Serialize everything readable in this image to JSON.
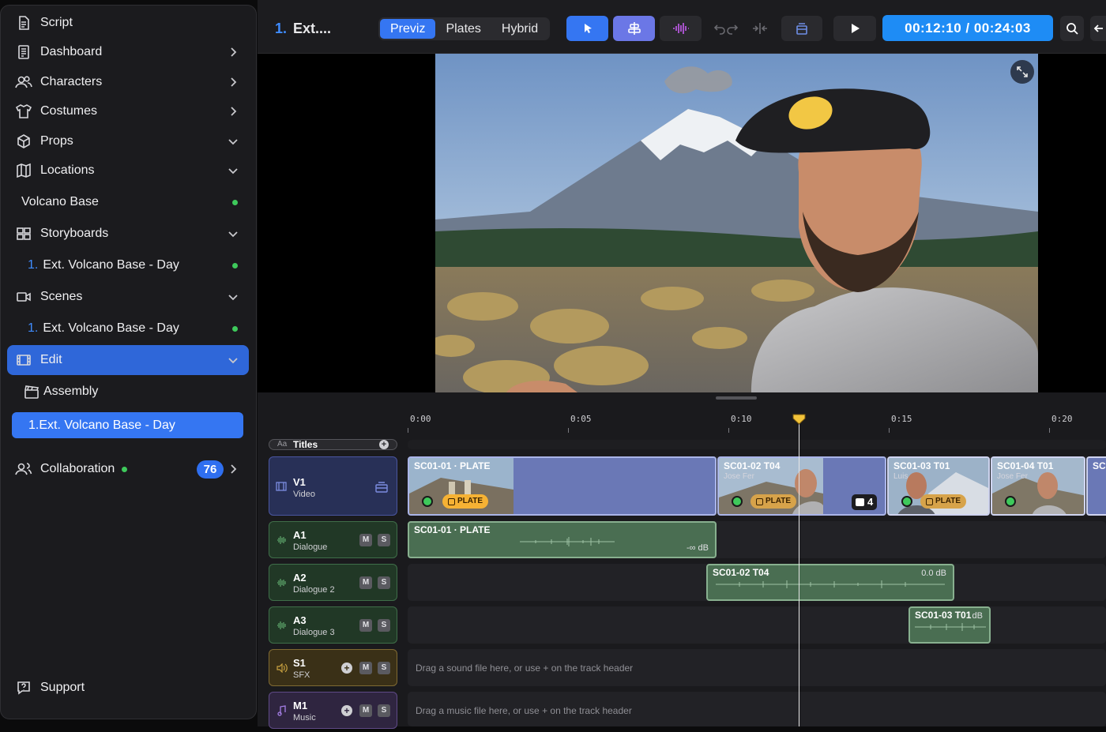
{
  "sidebar": {
    "items": [
      {
        "label": "Script"
      },
      {
        "label": "Dashboard"
      },
      {
        "label": "Characters"
      },
      {
        "label": "Costumes"
      },
      {
        "label": "Props"
      },
      {
        "label": "Locations"
      },
      {
        "label": "Volcano Base"
      },
      {
        "label": "Storyboards"
      },
      {
        "num": "1.",
        "label": "Ext. Volcano Base - Day"
      },
      {
        "label": "Scenes"
      },
      {
        "num": "1.",
        "label": "Ext. Volcano Base - Day"
      },
      {
        "label": "Edit"
      },
      {
        "label": "Assembly"
      },
      {
        "num": "1.",
        "label": "Ext. Volcano Base - Day"
      },
      {
        "label": "Collaboration",
        "badge": "76"
      },
      {
        "label": "Support"
      }
    ]
  },
  "toolbar": {
    "project_num": "1.",
    "project_title": "Ext....",
    "modes": [
      "Previz",
      "Plates",
      "Hybrid"
    ],
    "active_mode": "Previz",
    "timecode": "00:12:10 / 00:24:03"
  },
  "timeline": {
    "ruler": [
      "0:00",
      "0:05",
      "0:10",
      "0:15",
      "0:20"
    ],
    "playhead_seconds": 12.2,
    "titles_track": {
      "icon_text": "Aa",
      "label": "Titles"
    },
    "tracks": [
      {
        "id": "V1",
        "name": "Video"
      },
      {
        "id": "A1",
        "name": "Dialogue",
        "m": "M",
        "s": "S"
      },
      {
        "id": "A2",
        "name": "Dialogue 2",
        "m": "M",
        "s": "S"
      },
      {
        "id": "A3",
        "name": "Dialogue 3",
        "m": "M",
        "s": "S"
      },
      {
        "id": "S1",
        "name": "SFX",
        "m": "M",
        "s": "S",
        "hint": "Drag a sound file here, or use + on the track header"
      },
      {
        "id": "M1",
        "name": "Music",
        "m": "M",
        "s": "S",
        "hint": "Drag a music file here, or use + on the track header"
      }
    ],
    "video_clips": [
      {
        "title": "SC01-01 · PLATE",
        "badge": "PLATE"
      },
      {
        "title": "SC01-02 T04",
        "sub": "Jose Fer",
        "badge": "PLATE",
        "count": "4"
      },
      {
        "title": "SC01-03 T01",
        "sub": "Luis",
        "badge": "PLATE"
      },
      {
        "title": "SC01-04 T01",
        "sub": "Jose Fer"
      },
      {
        "title": "SC0"
      }
    ],
    "audio_clips": [
      {
        "title": "SC01-01 · PLATE",
        "level": "-∞ dB"
      },
      {
        "title": "SC01-02 T04",
        "level": "0.0 dB"
      },
      {
        "title": "SC01-03 T01",
        "level": "dB"
      }
    ]
  },
  "colors": {
    "accent": "#3576f2",
    "timecode_bg": "#1e8cf5",
    "ok_dot": "#3ec95b",
    "plate_badge": "#f6b234",
    "audio_clip": "#4a6e52",
    "video_clip": "#6a78b6"
  }
}
